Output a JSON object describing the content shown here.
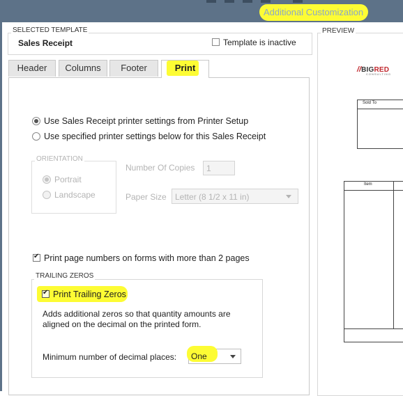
{
  "window": {
    "title": "Additional Customization",
    "highlight_color": "#fdfc34"
  },
  "selected_template": {
    "caption": "SELECTED TEMPLATE",
    "name": "Sales Receipt",
    "inactive_label": "Template is inactive",
    "inactive_checked": false
  },
  "preview": {
    "caption": "PREVIEW",
    "logo_mark": "//",
    "logo_word_1": "BIG",
    "logo_word_2": "RED",
    "logo_sub": "CONSULTING",
    "sold_to_label": "Sold To",
    "item_label": "Item"
  },
  "tabs": [
    {
      "label": "Header"
    },
    {
      "label": "Columns"
    },
    {
      "label": "Footer"
    },
    {
      "label": "Print",
      "active": true
    }
  ],
  "print": {
    "option_use": "Use Sales Receipt printer settings from Printer Setup",
    "option_use_selected": true,
    "option_specified": "Use specified printer settings below for this Sales Receipt",
    "orientation_caption": "ORIENTATION",
    "portrait_label": "Portrait",
    "portrait_selected": true,
    "landscape_label": "Landscape",
    "copies_label": "Number Of Copies",
    "copies_value": "1",
    "paper_label": "Paper Size",
    "paper_value": "Letter (8 1/2 x 11 in)",
    "page_numbers_label": "Print page numbers on forms with more than 2 pages",
    "page_numbers_checked": true
  },
  "trailing_zeros": {
    "caption": "TRAILING ZEROS",
    "label": "Print Trailing Zeros",
    "checked": true,
    "description": "Adds additional zeros so that quantity amounts are aligned on the decimal on the printed form.",
    "min_decimal_label": "Minimum number of decimal places:",
    "min_decimal_value": "One"
  }
}
